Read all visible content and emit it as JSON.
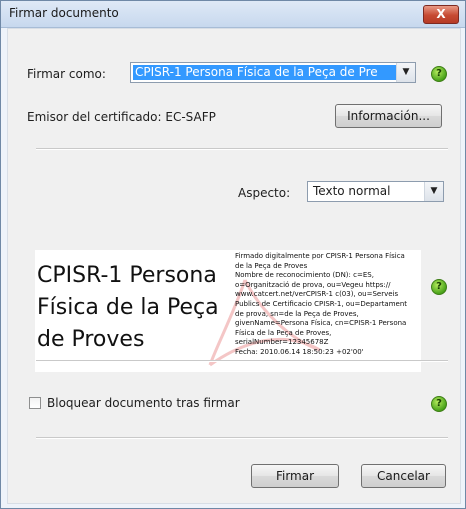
{
  "window": {
    "title": "Firmar documento",
    "close_label": "X"
  },
  "firmar_como": {
    "label": "Firmar como:",
    "selected": "CPISR-1 Persona Física de la Peça de Pre",
    "help": "?"
  },
  "emisor": {
    "label": "Emisor del certificado: EC-SAFP",
    "info_button": "Información..."
  },
  "aspecto": {
    "label": "Aspecto:",
    "selected": "Texto normal"
  },
  "signature_preview": {
    "name_lines": [
      "CPISR-1 Persona",
      "Física de la Peça",
      "de Proves"
    ],
    "details": [
      "Firmado digitalmente por CPISR-1 Persona Física",
      "de la Peça de Proves",
      "Nombre de reconocimiento (DN): c=ES,",
      "o=Organització de prova, ou=Vegeu https://",
      "www.catcert.net/verCPISR-1 c(03), ou=Serveis",
      "Publics de Certificacio CPISR-1, ou=Departament",
      "de prova, sn=de la Peça de Proves,",
      "givenName=Persona Física, cn=CPISR-1 Persona",
      "Física de la Peça de Proves,",
      "serialNumber=12345678Z",
      "Fecha: 2010.06.14 18:50:23 +02'00'"
    ],
    "help": "?"
  },
  "bloquear": {
    "label": "Bloquear documento tras firmar",
    "checked": false,
    "help": "?"
  },
  "buttons": {
    "firmar": "Firmar",
    "cancelar": "Cancelar"
  },
  "colors": {
    "selection": "#3399ff",
    "help_green": "#4aa31b"
  }
}
